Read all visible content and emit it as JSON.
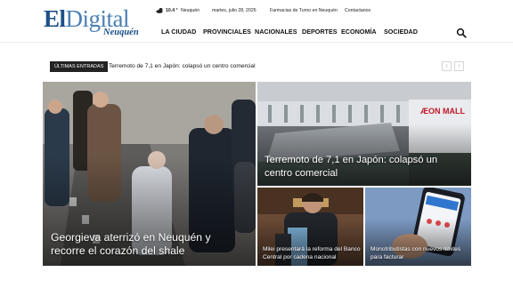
{
  "logo": {
    "part1": "El",
    "part2": "Digital",
    "subtitle": "Neuquén"
  },
  "topbar": {
    "weather_icon": "partly-cloudy-icon",
    "temperature": "10.4 °",
    "city": "Neuquén",
    "date": "martes, julio 28, 2026",
    "links": [
      "Farmacias de Turno en Neuquén",
      "Contactanos"
    ]
  },
  "nav": {
    "items": [
      "LA CIUDAD",
      "PROVINCIALES",
      "NACIONALES",
      "DEPORTES",
      "ECONOMÍA",
      "SOCIEDAD"
    ],
    "search_icon": "search-icon"
  },
  "ticker": {
    "badge": "ÚLTIMAS ENTRADAS",
    "headline": "Terremoto de 7,1 en Japón: colapsó un centro comercial",
    "prev_label": "‹",
    "next_label": "›"
  },
  "featured": [
    {
      "title": "Georgieva aterrizó en Neuquén y recorre el corazón del shale"
    },
    {
      "title": "Terremoto de 7,1 en Japón: colapsó un centro comercial",
      "sign_text": "ÆON MALL"
    },
    {
      "title": "Milei presentará la reforma del Banco Central por cadena nacional"
    },
    {
      "title": "Monotributistas con nuevos límites para facturar"
    }
  ],
  "colors": {
    "brand_dark": "#1c4f87",
    "brand_light": "#4a7fb3",
    "ticker_badge": "#222222"
  }
}
